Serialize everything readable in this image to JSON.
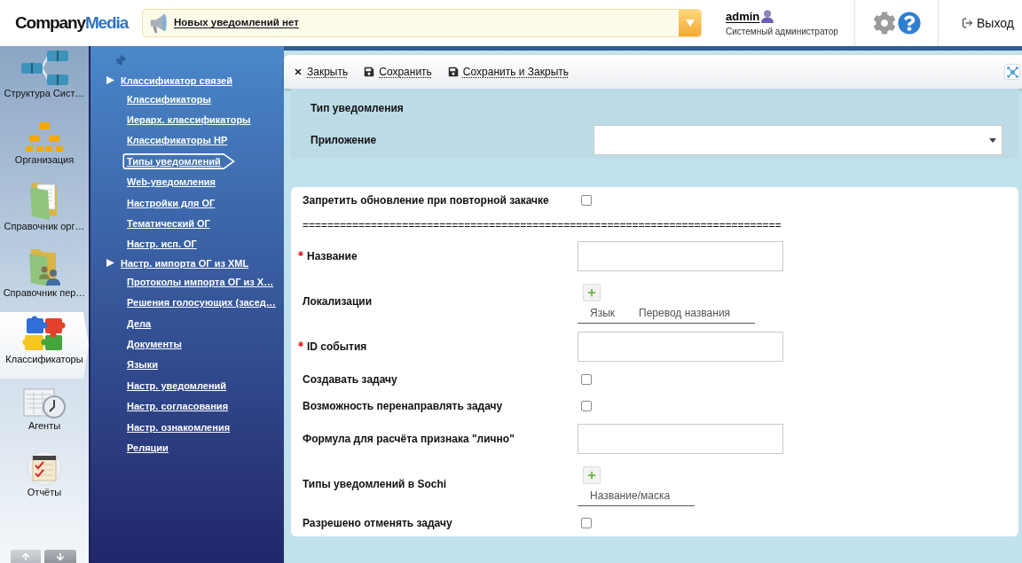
{
  "header": {
    "logo": {
      "first": "Company",
      "second": "Media"
    },
    "notification": {
      "text": "Новых уведомлений нет"
    },
    "user": {
      "name": "admin",
      "role": "Системный администратор"
    },
    "logout": {
      "label": "Выход"
    }
  },
  "app_nav": {
    "items": [
      {
        "label": "Структура Сист…",
        "kind": "structure",
        "selected": false
      },
      {
        "label": "Организация",
        "kind": "organization",
        "selected": false
      },
      {
        "label": "Справочник орг…",
        "kind": "org_directory",
        "selected": false
      },
      {
        "label": "Справочник пер…",
        "kind": "person_directory",
        "selected": false
      },
      {
        "label": "Классификаторы",
        "kind": "classifiers",
        "selected": true
      },
      {
        "label": "Агенты",
        "kind": "agents",
        "selected": false
      },
      {
        "label": "Отчёты",
        "kind": "reports",
        "selected": false
      }
    ]
  },
  "sub_nav": {
    "items": [
      {
        "label": "Классификатор связей",
        "selected": false,
        "children": [
          {
            "label": "Классификаторы",
            "selected": false
          },
          {
            "label": "Иерарх. классификаторы",
            "selected": false
          },
          {
            "label": "Классификаторы НР",
            "selected": false
          },
          {
            "label": "Типы уведомлений",
            "selected": true
          },
          {
            "label": "Web-уведомления",
            "selected": false
          },
          {
            "label": "Настройки для ОГ",
            "selected": false
          },
          {
            "label": "Тематический ОГ",
            "selected": false
          },
          {
            "label": "Настр. исп. ОГ",
            "selected": false
          }
        ]
      },
      {
        "label": "Настр. импорта ОГ из XML",
        "selected": false,
        "children": [
          {
            "label": "Протоколы импорта ОГ из Х…",
            "selected": false
          },
          {
            "label": "Решения голосующих (засед…",
            "selected": false
          },
          {
            "label": "Дела",
            "selected": false
          },
          {
            "label": "Документы",
            "selected": false
          },
          {
            "label": "Языки",
            "selected": false
          },
          {
            "label": "Настр. уведомлений",
            "selected": false
          },
          {
            "label": "Настр. согласования",
            "selected": false
          },
          {
            "label": "Настр. ознакомления",
            "selected": false
          },
          {
            "label": "Реляции",
            "selected": false
          }
        ]
      }
    ]
  },
  "toolbar": {
    "buttons": [
      {
        "kind": "close",
        "label": "Закрыть"
      },
      {
        "kind": "save",
        "label": "Сохранить"
      },
      {
        "kind": "save",
        "label": "Сохранить и Закрыть"
      }
    ]
  },
  "header_panel": {
    "title": "Тип уведомления",
    "fields": [
      {
        "label": "Приложение",
        "kind": "select"
      }
    ]
  },
  "form": {
    "rows": [
      {
        "kind": "checkbox",
        "label": "Запретить обновление при повторной закачке",
        "required": false,
        "checked": false
      },
      {
        "kind": "separator",
        "text": "============================================================================="
      },
      {
        "kind": "text",
        "label": "Название",
        "required": true
      },
      {
        "kind": "list",
        "label": "Локализации",
        "required": false,
        "columns": [
          "Язык",
          "Перевод названия"
        ]
      },
      {
        "kind": "text",
        "label": "ID события",
        "required": true
      },
      {
        "kind": "checkbox",
        "label": "Создавать задачу",
        "required": false,
        "checked": false
      },
      {
        "kind": "checkbox",
        "label": "Возможность перенаправлять задачу",
        "required": false,
        "checked": false
      },
      {
        "kind": "text",
        "label": "Формула для расчёта признака \"лично\"",
        "required": false
      },
      {
        "kind": "list",
        "label": "Типы уведомлений в Sochi",
        "required": false,
        "columns": [
          "Название/маска"
        ]
      },
      {
        "kind": "checkbox",
        "label": "Разрешено отменять задачу",
        "required": false,
        "checked": false
      }
    ]
  }
}
